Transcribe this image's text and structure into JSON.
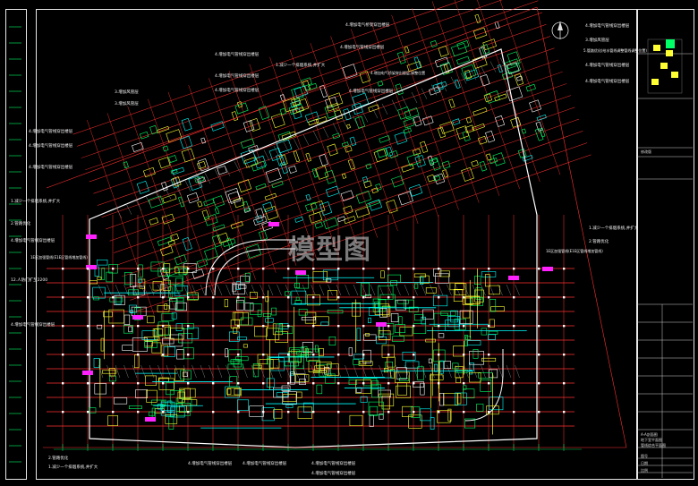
{
  "drawing": {
    "watermark": "模型图",
    "colors": {
      "background": "#000000",
      "axis_lines": "#ff3030",
      "walls": "#ffffff",
      "rooms": "#00ff66",
      "equipment": "#ffff33",
      "ducts": "#00ffff",
      "highlight": "#ff22ff",
      "hatch": "#7a7a7a"
    },
    "notes": [
      "4.增加电气桥架穿出楼层",
      "4.增加电气管线穿出楼层",
      "1.减少一个排烟系统,并扩大",
      "3.增加风管层",
      "4.增加电气管线穿出楼层",
      "4.增加电气管线穿出楼层",
      "3.增加风管层",
      "4.增加电气管线穿出楼层",
      "4.增加电气管线穿出楼层",
      "4.增加电气管线穿出楼层",
      "4.增加电气管线穿出楼层",
      "4.增加电气管线穿出楼层",
      "4.增加电气管线穿出楼层",
      "1.减少一个排烟系统,并扩大",
      "2.管路优化",
      "4.增加电气管线穿出楼层",
      "1E区加强管线(E1E区管线增加管线)",
      "12.人防门扩至2200",
      "4.增加电气管线穿出楼层",
      "4.增加电气桥架穿出楼层,调整位置",
      "3.增加风管层",
      "5.管路优化(给水管线调整管线调整位置)",
      "4.增加电气管线穿出楼层",
      "4.增加电气管线穿出楼层",
      "1.减少一个排烟系统,并扩大",
      "2.管路优化",
      "1E区加强管线(E1E区管线增加管线)",
      "2.管路优化",
      "1.减少一个排烟系统,并扩大",
      "4.增加电气管线穿出楼层",
      "4.增加电气管线穿出楼层",
      "4.增加电气管线穿出楼层",
      "4.增加电气管线穿出楼层"
    ],
    "title_block": {
      "rows": [
        "修改版",
        "A-A剖面图",
        "地下室平面图",
        "管线综合平面图",
        "图号",
        "日期",
        "比例"
      ]
    }
  }
}
